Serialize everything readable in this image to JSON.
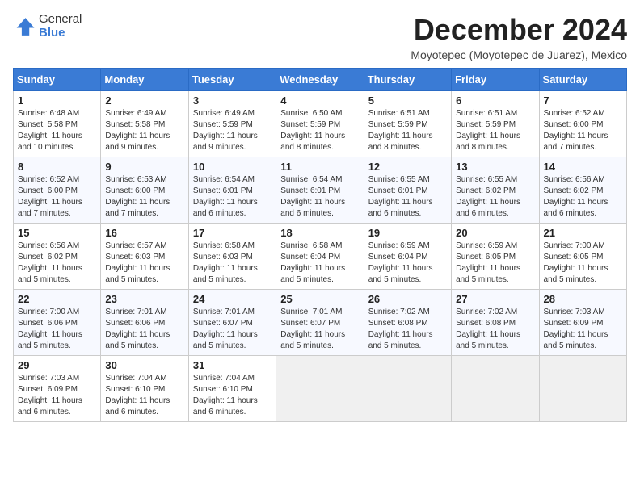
{
  "logo": {
    "general": "General",
    "blue": "Blue"
  },
  "title": "December 2024",
  "subtitle": "Moyotepec (Moyotepec de Juarez), Mexico",
  "headers": [
    "Sunday",
    "Monday",
    "Tuesday",
    "Wednesday",
    "Thursday",
    "Friday",
    "Saturday"
  ],
  "weeks": [
    [
      {
        "day": "1",
        "rise": "6:48 AM",
        "set": "5:58 PM",
        "daylight": "11 hours and 10 minutes."
      },
      {
        "day": "2",
        "rise": "6:49 AM",
        "set": "5:58 PM",
        "daylight": "11 hours and 9 minutes."
      },
      {
        "day": "3",
        "rise": "6:49 AM",
        "set": "5:59 PM",
        "daylight": "11 hours and 9 minutes."
      },
      {
        "day": "4",
        "rise": "6:50 AM",
        "set": "5:59 PM",
        "daylight": "11 hours and 8 minutes."
      },
      {
        "day": "5",
        "rise": "6:51 AM",
        "set": "5:59 PM",
        "daylight": "11 hours and 8 minutes."
      },
      {
        "day": "6",
        "rise": "6:51 AM",
        "set": "5:59 PM",
        "daylight": "11 hours and 8 minutes."
      },
      {
        "day": "7",
        "rise": "6:52 AM",
        "set": "6:00 PM",
        "daylight": "11 hours and 7 minutes."
      }
    ],
    [
      {
        "day": "8",
        "rise": "6:52 AM",
        "set": "6:00 PM",
        "daylight": "11 hours and 7 minutes."
      },
      {
        "day": "9",
        "rise": "6:53 AM",
        "set": "6:00 PM",
        "daylight": "11 hours and 7 minutes."
      },
      {
        "day": "10",
        "rise": "6:54 AM",
        "set": "6:01 PM",
        "daylight": "11 hours and 6 minutes."
      },
      {
        "day": "11",
        "rise": "6:54 AM",
        "set": "6:01 PM",
        "daylight": "11 hours and 6 minutes."
      },
      {
        "day": "12",
        "rise": "6:55 AM",
        "set": "6:01 PM",
        "daylight": "11 hours and 6 minutes."
      },
      {
        "day": "13",
        "rise": "6:55 AM",
        "set": "6:02 PM",
        "daylight": "11 hours and 6 minutes."
      },
      {
        "day": "14",
        "rise": "6:56 AM",
        "set": "6:02 PM",
        "daylight": "11 hours and 6 minutes."
      }
    ],
    [
      {
        "day": "15",
        "rise": "6:56 AM",
        "set": "6:02 PM",
        "daylight": "11 hours and 5 minutes."
      },
      {
        "day": "16",
        "rise": "6:57 AM",
        "set": "6:03 PM",
        "daylight": "11 hours and 5 minutes."
      },
      {
        "day": "17",
        "rise": "6:58 AM",
        "set": "6:03 PM",
        "daylight": "11 hours and 5 minutes."
      },
      {
        "day": "18",
        "rise": "6:58 AM",
        "set": "6:04 PM",
        "daylight": "11 hours and 5 minutes."
      },
      {
        "day": "19",
        "rise": "6:59 AM",
        "set": "6:04 PM",
        "daylight": "11 hours and 5 minutes."
      },
      {
        "day": "20",
        "rise": "6:59 AM",
        "set": "6:05 PM",
        "daylight": "11 hours and 5 minutes."
      },
      {
        "day": "21",
        "rise": "7:00 AM",
        "set": "6:05 PM",
        "daylight": "11 hours and 5 minutes."
      }
    ],
    [
      {
        "day": "22",
        "rise": "7:00 AM",
        "set": "6:06 PM",
        "daylight": "11 hours and 5 minutes."
      },
      {
        "day": "23",
        "rise": "7:01 AM",
        "set": "6:06 PM",
        "daylight": "11 hours and 5 minutes."
      },
      {
        "day": "24",
        "rise": "7:01 AM",
        "set": "6:07 PM",
        "daylight": "11 hours and 5 minutes."
      },
      {
        "day": "25",
        "rise": "7:01 AM",
        "set": "6:07 PM",
        "daylight": "11 hours and 5 minutes."
      },
      {
        "day": "26",
        "rise": "7:02 AM",
        "set": "6:08 PM",
        "daylight": "11 hours and 5 minutes."
      },
      {
        "day": "27",
        "rise": "7:02 AM",
        "set": "6:08 PM",
        "daylight": "11 hours and 5 minutes."
      },
      {
        "day": "28",
        "rise": "7:03 AM",
        "set": "6:09 PM",
        "daylight": "11 hours and 5 minutes."
      }
    ],
    [
      {
        "day": "29",
        "rise": "7:03 AM",
        "set": "6:09 PM",
        "daylight": "11 hours and 6 minutes."
      },
      {
        "day": "30",
        "rise": "7:04 AM",
        "set": "6:10 PM",
        "daylight": "11 hours and 6 minutes."
      },
      {
        "day": "31",
        "rise": "7:04 AM",
        "set": "6:10 PM",
        "daylight": "11 hours and 6 minutes."
      },
      null,
      null,
      null,
      null
    ]
  ]
}
